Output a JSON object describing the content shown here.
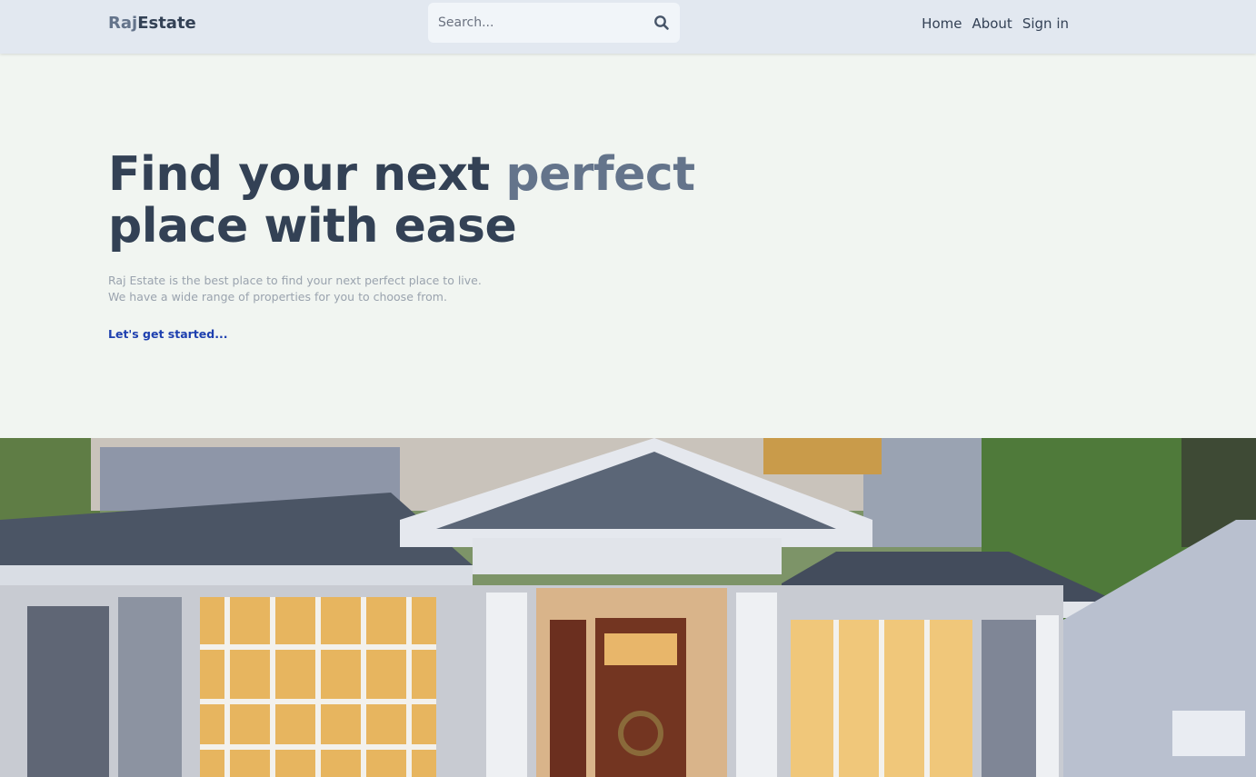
{
  "brand": {
    "part1": "Raj",
    "part2": "Estate"
  },
  "search": {
    "placeholder": "Search..."
  },
  "nav": {
    "home": "Home",
    "about": "About",
    "signin": "Sign in"
  },
  "hero": {
    "title_part1": "Find your next ",
    "title_highlight": "perfect",
    "title_part2": "place with ease",
    "desc_line1": "Raj Estate is the best place to find your next perfect place to live.",
    "desc_line2": "We have a wide range of properties for you to choose from.",
    "cta": "Let's get started..."
  },
  "icons": {
    "search": "search-icon"
  },
  "colors": {
    "accent": "#64748b",
    "text_dark": "#334155",
    "link": "#1e40af",
    "header_bg": "#e2e8f0",
    "page_bg": "#f1f5f1"
  }
}
